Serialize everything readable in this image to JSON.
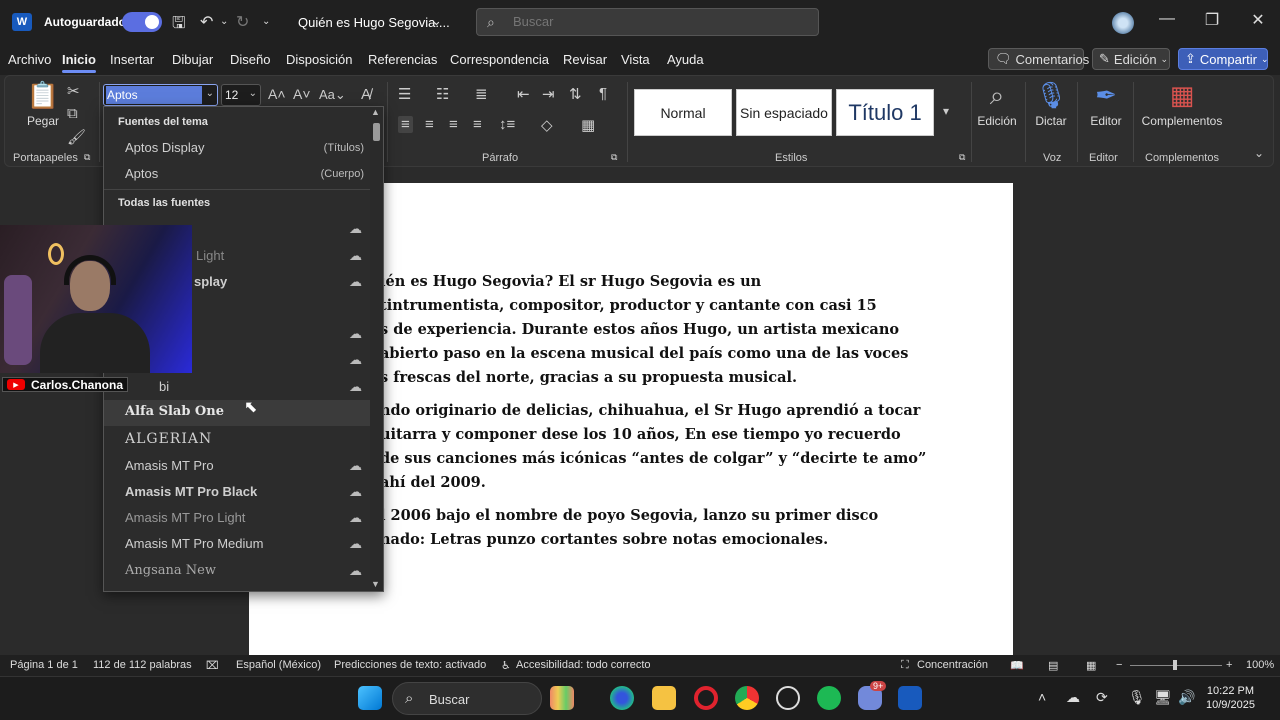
{
  "titlebar": {
    "autosave_label": "Autoguardado",
    "doc_title": "Quién es Hugo Segovia....",
    "search_placeholder": "Buscar"
  },
  "menu": {
    "tabs": [
      "Archivo",
      "Inicio",
      "Insertar",
      "Dibujar",
      "Diseño",
      "Disposición",
      "Referencias",
      "Correspondencia",
      "Revisar",
      "Vista",
      "Ayuda"
    ],
    "active_tab": "Inicio",
    "comments": "Comentarios",
    "editing": "Edición",
    "share": "Compartir"
  },
  "ribbon": {
    "paste": "Pegar",
    "clipboard": "Portapapeles",
    "font_name": "Aptos",
    "font_size": "12",
    "paragraph": "Párrafo",
    "styles_group": "Estilos",
    "styles": [
      "Normal",
      "Sin espaciado",
      "Título 1"
    ],
    "edicion": "Edición",
    "dictar": "Dictar",
    "voz": "Voz",
    "editor": "Editor",
    "editor_group": "Editor",
    "complementos": "Complementos",
    "complementos_group": "Complementos"
  },
  "font_dropdown": {
    "theme_header": "Fuentes del tema",
    "theme_fonts": [
      {
        "name": "Aptos Display",
        "tag": "(Títulos)"
      },
      {
        "name": "Aptos",
        "tag": "(Cuerpo)"
      }
    ],
    "all_header": "Todas las fuentes",
    "partial_fonts": [
      "Light",
      "splay",
      "bi"
    ],
    "fonts": [
      "Alfa Slab One",
      "ALGERIAN",
      "Amasis MT Pro",
      "Amasis MT Pro Black",
      "Amasis MT Pro Light",
      "Amasis MT Pro Medium",
      "Angsana New"
    ]
  },
  "document": {
    "paragraphs": [
      [
        "ién es Hugo Segovia? El sr Hugo Segovia es un",
        "tintrumentista, compositor, productor y cantante con casi 15",
        "s de experiencia. Durante estos años Hugo, un artista mexicano",
        "abierto paso en la escena musical del país como una de las voces",
        "s frescas del norte, gracias a su propuesta musical."
      ],
      [
        "ndo originario de delicias, chihuahua, el Sr Hugo aprendió a tocar",
        "uitarra y componer dese los 10 años, En ese tiempo yo recuerdo",
        "de sus canciones más icónicas “antes de colgar” y “decirte te amo”",
        "ahí del 2009."
      ],
      [
        "l 2006 bajo el nombre de poyo Segovia, lanzo su primer disco",
        "nado: Letras punzo cortantes sobre notas emocionales."
      ]
    ]
  },
  "webcam": {
    "channel": "Carlos.Chanona"
  },
  "statusbar": {
    "page": "Página 1 de 1",
    "words": "112 de 112 palabras",
    "language": "Español (México)",
    "predictions": "Predicciones de texto: activado",
    "accessibility": "Accesibilidad: todo correcto",
    "focus": "Concentración",
    "zoom": "100%"
  },
  "taskbar": {
    "search": "Buscar",
    "time": "10:22 PM",
    "date": "10/9/2025",
    "badge": "9+"
  }
}
